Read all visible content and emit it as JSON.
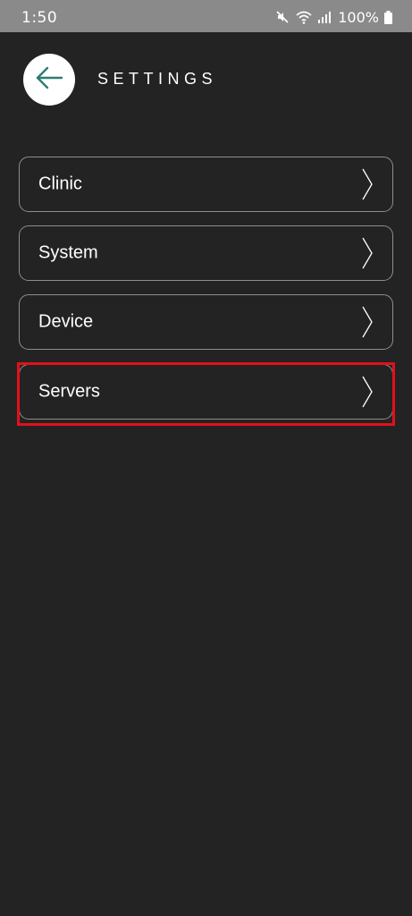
{
  "status_bar": {
    "time": "1:50",
    "battery": "100%",
    "icons": [
      "mute-icon",
      "wifi-icon",
      "signal-icon",
      "battery-icon"
    ]
  },
  "header": {
    "back_icon": "arrow-left-icon",
    "title": "SETTINGS"
  },
  "menu": {
    "items": [
      {
        "label": "Clinic",
        "icon": "chevron-right-icon"
      },
      {
        "label": "System",
        "icon": "chevron-right-icon"
      },
      {
        "label": "Device",
        "icon": "chevron-right-icon"
      },
      {
        "label": "Servers",
        "icon": "chevron-right-icon",
        "highlighted": true
      }
    ]
  },
  "colors": {
    "background": "#232323",
    "status_bar": "#8a8a8a",
    "accent_teal": "#2e7d74",
    "item_border": "#8d8d8d",
    "highlight": "#e3101a"
  }
}
